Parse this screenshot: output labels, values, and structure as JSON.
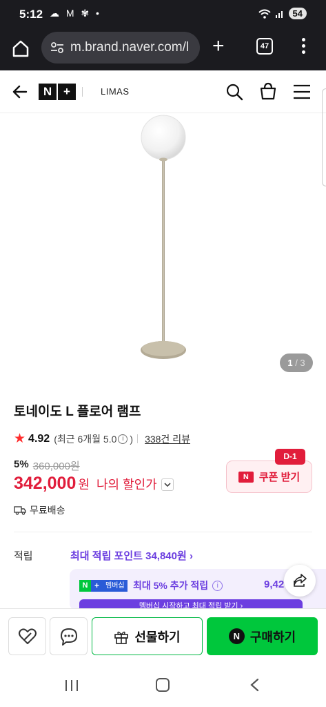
{
  "status": {
    "time": "5:12",
    "left_icons": "☁ M ✾ •",
    "battery": "54"
  },
  "browser": {
    "url": "m.brand.naver.com/l",
    "tab_count": "47"
  },
  "header": {
    "logo_n": "N",
    "logo_plus": "+",
    "brand": "LIMAS"
  },
  "gallery": {
    "current": "1",
    "total": "/ 3"
  },
  "product": {
    "title": "토네이도 L 플로어 램프",
    "rating": "4.92",
    "recent_rating": "(최근 6개월 5.0",
    "recent_close": ")",
    "reviews": "338건 리뷰",
    "discount_rate": "5%",
    "original_price": "360,000원",
    "price": "342,000",
    "price_unit": "원",
    "my_discount": "나의 할인가",
    "shipping": "무료배송",
    "coupon_label": "쿠폰 받기",
    "coupon_n": "N",
    "dday": "D-1"
  },
  "points": {
    "label": "적립",
    "max": "최대 적립 포인트 34,840원 ›",
    "member_badge": "멤버십",
    "member_text": "최대 5% 추가 적립",
    "member_amount": "9,42",
    "strip_text": "멤버십 시작하고 최대 적립 받기 ›"
  },
  "bottom": {
    "gift": "선물하기",
    "buy": "구매하기",
    "buy_n": "N"
  },
  "colors": {
    "accent_red": "#e11d3b",
    "naver_green": "#00c73c",
    "points_purple": "#6c3fe0"
  }
}
